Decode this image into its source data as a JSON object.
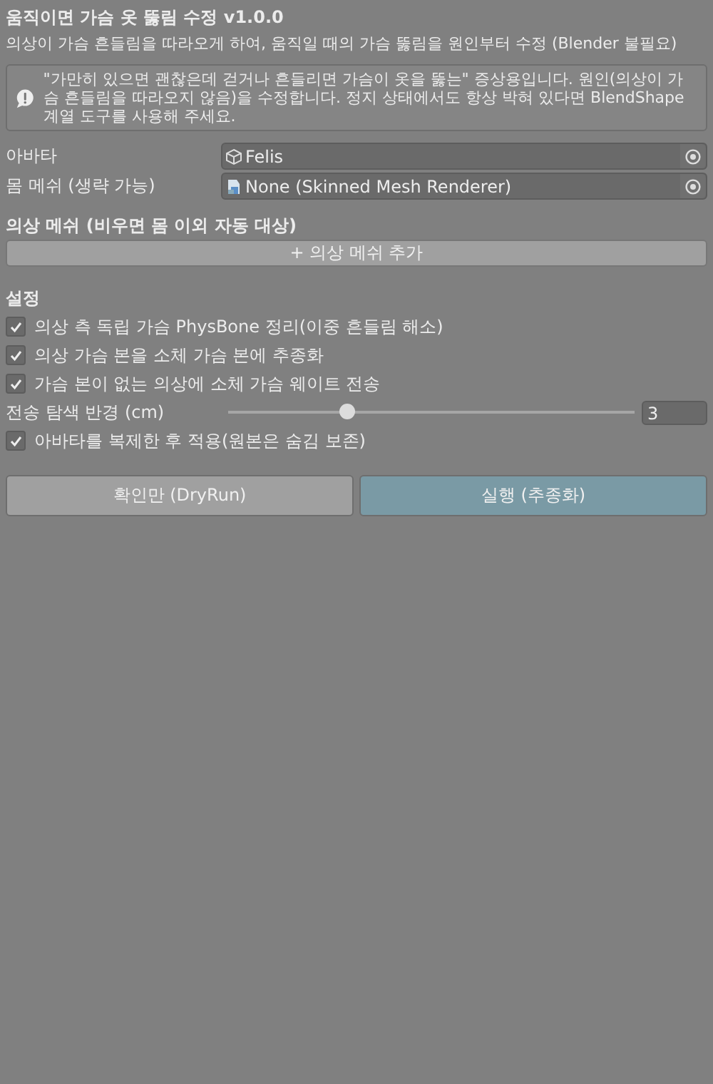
{
  "title": "움직이면 가슴 옷 뚫림 수정 v1.0.0",
  "subtitle": "의상이 가슴 흔들림을 따라오게 하여, 움직일 때의 가슴 뚫림을 원인부터 수정 (Blender 불필요)",
  "help": {
    "text": "\"가만히 있으면 괜찮은데 걷거나 흔들리면 가슴이 옷을 뚫는\" 증상용입니다. 원인(의상이 가슴 흔들림을 따라오지 않음)을 수정합니다. 정지 상태에서도 항상 박혀 있다면 BlendShape 계열 도구를 사용해 주세요."
  },
  "fields": [
    {
      "label": "아바타",
      "value": "Felis",
      "kind": "object"
    },
    {
      "label": "몸 메쉬 (생략 가능)",
      "value": "None (Skinned Mesh Renderer)",
      "kind": "mesh"
    }
  ],
  "clothing": {
    "heading": "의상 메쉬 (비우면 몸 이외 자동 대상)",
    "add_button": "+ 의상 메쉬 추가"
  },
  "settings": {
    "heading": "설정",
    "items": [
      {
        "kind": "checkbox",
        "label": "의상 측 독립 가슴 PhysBone 정리(이중 흔들림 해소)",
        "checked": true
      },
      {
        "kind": "checkbox",
        "label": "의상 가슴 본을 소체 가슴 본에 추종화",
        "checked": true
      },
      {
        "kind": "checkbox",
        "label": "가슴 본이 없는 의상에 소체 가슴 웨이트 전송",
        "checked": true
      },
      {
        "kind": "slider",
        "label": "전송 탐색 반경 (cm)",
        "level": 0.29,
        "value": "3"
      },
      {
        "kind": "checkbox",
        "label": "아바타를 복제한 후 적용(원본은 숨김 보존)",
        "checked": true
      }
    ]
  },
  "buttons": [
    {
      "label": "확인만 (DryRun)",
      "primary": false
    },
    {
      "label": "실행 (추종화)",
      "primary": true
    }
  ]
}
